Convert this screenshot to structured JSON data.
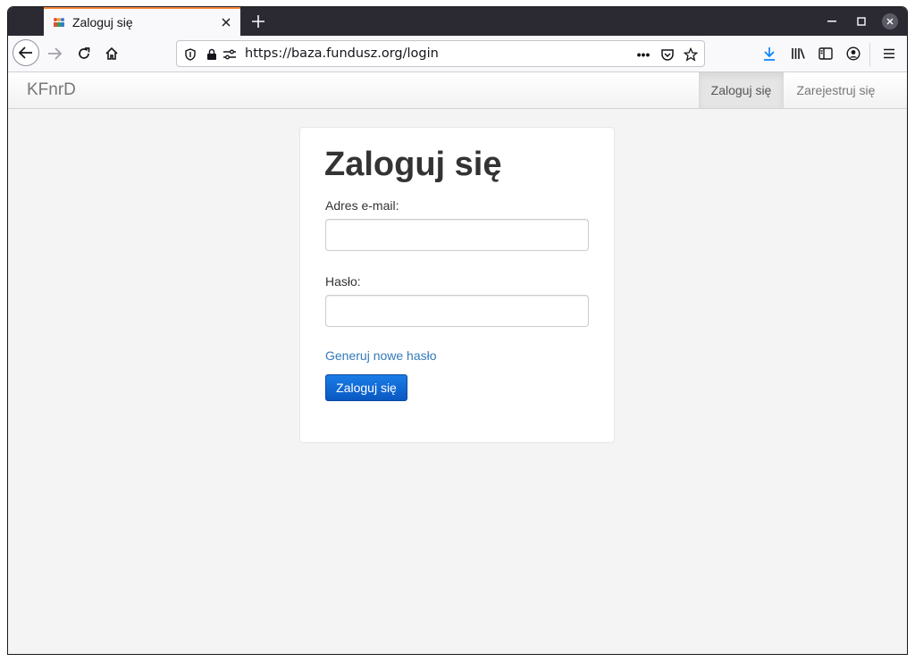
{
  "browser": {
    "tab_title": "Zaloguj się",
    "url": "https://baza.fundusz.org/login",
    "url_more": "•••"
  },
  "site": {
    "brand": "KFnrD",
    "nav": [
      {
        "label": "Zaloguj się",
        "active": true
      },
      {
        "label": "Zarejestruj się",
        "active": false
      }
    ]
  },
  "login": {
    "heading": "Zaloguj się",
    "email_label": "Adres e-mail:",
    "email_value": "",
    "password_label": "Hasło:",
    "password_value": "",
    "reset_link": "Generuj nowe hasło",
    "submit_label": "Zaloguj się"
  },
  "colors": {
    "accent_link": "#337ab7",
    "button_primary": "#0a58c2",
    "tab_highlight": "#ff8a3d",
    "download_icon": "#0a84ff"
  }
}
